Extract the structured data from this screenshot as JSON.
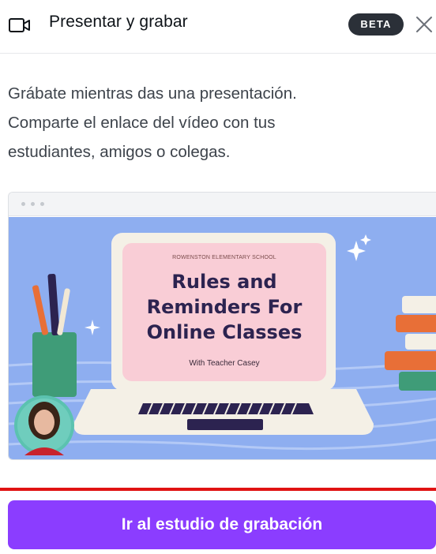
{
  "header": {
    "title": "Presentar y grabar",
    "badge": "BETA",
    "camera_icon": "video-camera-icon",
    "close_icon": "close-icon"
  },
  "description": {
    "line1": "Grábate mientras das una presentación.",
    "line2": "Comparte el enlace del vídeo con tus",
    "line3": "estudiantes, amigos o colegas."
  },
  "preview": {
    "school": "ROWENSTON ELEMENTARY SCHOOL",
    "title_line1": "Rules and",
    "title_line2": "Reminders For",
    "title_line3": "Online Classes",
    "subtitle": "With Teacher Casey"
  },
  "cta": {
    "label": "Ir al estudio de grabación"
  },
  "colors": {
    "accent": "#8b3dff",
    "badge": "#2b3038",
    "highlight_line": "#e01212",
    "slide_bg": "#8eaef0",
    "slide_card": "#f9cdd6"
  }
}
